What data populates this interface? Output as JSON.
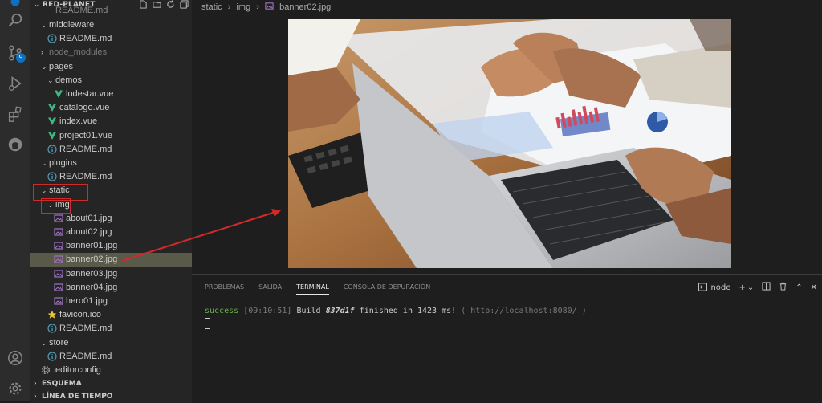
{
  "explorer": {
    "title": "RED-PLANET",
    "top_clip": "README.md",
    "items": [
      {
        "label": "middleware",
        "type": "folder-open",
        "indent": 1
      },
      {
        "label": "README.md",
        "type": "info",
        "indent": 2
      },
      {
        "label": "node_modules",
        "type": "folder-closed-dim",
        "indent": 1
      },
      {
        "label": "pages",
        "type": "folder-open",
        "indent": 1
      },
      {
        "label": "demos",
        "type": "folder-open",
        "indent": 2
      },
      {
        "label": "lodestar.vue",
        "type": "vue",
        "indent": 3
      },
      {
        "label": "catalogo.vue",
        "type": "vue",
        "indent": 2
      },
      {
        "label": "index.vue",
        "type": "vue",
        "indent": 2
      },
      {
        "label": "project01.vue",
        "type": "vue",
        "indent": 2
      },
      {
        "label": "README.md",
        "type": "info",
        "indent": 2
      },
      {
        "label": "plugins",
        "type": "folder-open",
        "indent": 1
      },
      {
        "label": "README.md",
        "type": "info",
        "indent": 2
      },
      {
        "label": "static",
        "type": "folder-open",
        "indent": 1
      },
      {
        "label": "img",
        "type": "folder-open",
        "indent": 2
      },
      {
        "label": "about01.jpg",
        "type": "image",
        "indent": 3
      },
      {
        "label": "about02.jpg",
        "type": "image",
        "indent": 3
      },
      {
        "label": "banner01.jpg",
        "type": "image",
        "indent": 3
      },
      {
        "label": "banner02.jpg",
        "type": "image",
        "indent": 3,
        "selected": true
      },
      {
        "label": "banner03.jpg",
        "type": "image",
        "indent": 3
      },
      {
        "label": "banner04.jpg",
        "type": "image",
        "indent": 3
      },
      {
        "label": "hero01.jpg",
        "type": "image",
        "indent": 3
      },
      {
        "label": "favicon.ico",
        "type": "star",
        "indent": 2
      },
      {
        "label": "README.md",
        "type": "info",
        "indent": 2
      },
      {
        "label": "store",
        "type": "folder-open",
        "indent": 1
      },
      {
        "label": "README.md",
        "type": "info",
        "indent": 2
      },
      {
        "label": ".editorconfig",
        "type": "gear",
        "indent": 1
      }
    ],
    "outline_label": "ESQUEMA",
    "timeline_label": "LÍNEA DE TIEMPO"
  },
  "breadcrumb": {
    "parts": [
      "static",
      "img",
      "banner02.jpg"
    ]
  },
  "panel": {
    "tabs": [
      "PROBLEMAS",
      "SALIDA",
      "TERMINAL",
      "CONSOLA DE DEPURACIÓN"
    ],
    "active_tab": "TERMINAL",
    "terminal_name": "node",
    "terminal": {
      "status": "success",
      "time": "[09:10:51]",
      "build_label": "Build",
      "hash": "837d1f",
      "message": "finished in 1423 ms!",
      "link_open": "(",
      "url": "http://localhost:8080/",
      "link_close": ")"
    }
  },
  "activity": {
    "badge": "9",
    "icons": [
      "files-icon",
      "search-icon",
      "source-control-icon",
      "run-debug-icon",
      "extensions-icon",
      "github-icon",
      "account-icon",
      "manage-gear-icon"
    ]
  },
  "colors": {
    "annotation_red": "#d12a2a",
    "vue_green": "#41b883",
    "info_blue": "#519aba",
    "image_purple": "#a074c4",
    "star_yellow": "#e8c33b",
    "success_green": "#6ab04c"
  }
}
